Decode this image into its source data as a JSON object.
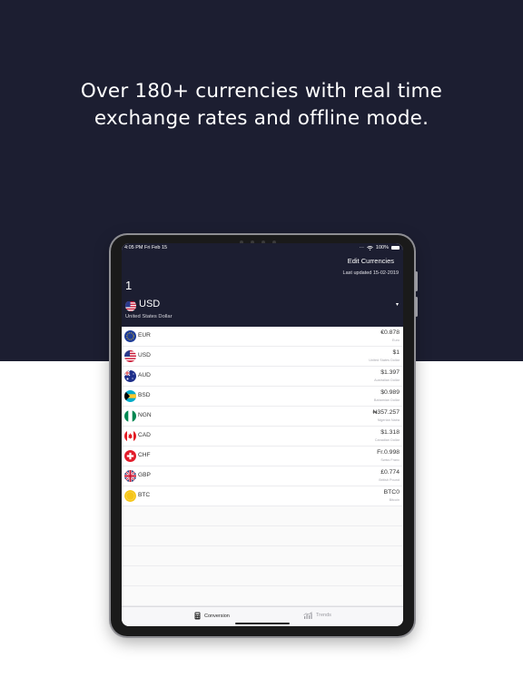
{
  "headline": {
    "line1": "Over 180+ currencies with real time",
    "line2": "exchange rates and offline mode."
  },
  "status_bar": {
    "time": "4:05 PM  Fri Feb 15",
    "battery": "100%"
  },
  "header": {
    "edit_label": "Edit Currencies",
    "last_updated": "Last updated 15-02-2019",
    "amount": "1",
    "base_code": "USD",
    "base_name": "United States Dollar",
    "caret": "▾"
  },
  "currencies": [
    {
      "code": "EUR",
      "value": "€0.878",
      "name": "Euro",
      "flag": "eu-flag-icon"
    },
    {
      "code": "USD",
      "value": "$1",
      "name": "United States Dollar",
      "flag": "us-flag-icon"
    },
    {
      "code": "AUD",
      "value": "$1.397",
      "name": "Australian Dollar",
      "flag": "au-flag-icon"
    },
    {
      "code": "BSD",
      "value": "$0.989",
      "name": "Bahamian Dollar",
      "flag": "bs-flag-icon"
    },
    {
      "code": "NGN",
      "value": "₦357.257",
      "name": "Nigerian Naira",
      "flag": "ng-flag-icon"
    },
    {
      "code": "CAD",
      "value": "$1.318",
      "name": "Canadian Dollar",
      "flag": "ca-flag-icon"
    },
    {
      "code": "CHF",
      "value": "Fr.0.998",
      "name": "Swiss Franc",
      "flag": "ch-flag-icon"
    },
    {
      "code": "GBP",
      "value": "£0.774",
      "name": "British Pound",
      "flag": "gb-flag-icon"
    },
    {
      "code": "BTC",
      "value": "BTC0",
      "name": "Bitcoin",
      "flag": "btc-coin-icon"
    }
  ],
  "tabs": {
    "conversion": "Conversion",
    "trends": "Trends"
  },
  "colors": {
    "navy": "#1c1e31",
    "bitcoin": "#f5c518"
  }
}
